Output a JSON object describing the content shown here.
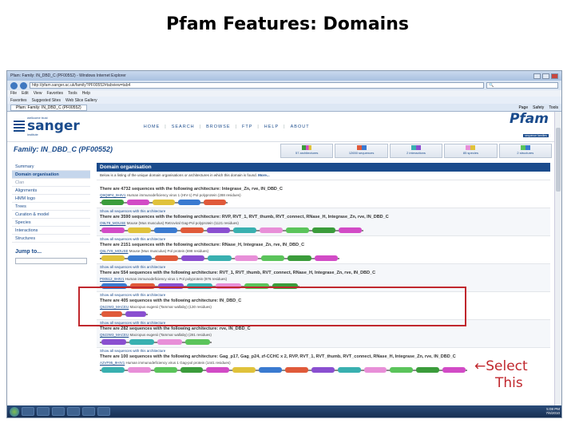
{
  "slide": {
    "title": "Pfam Features: Domains"
  },
  "browser": {
    "window_title": "Pfam: Family: IN_DBD_C (PF00552) - Windows Internet Explorer",
    "url": "http://pfam.sanger.ac.uk/family?PF00552#tabview=tab4",
    "menu": [
      "File",
      "Edit",
      "View",
      "Favorites",
      "Tools",
      "Help"
    ],
    "favorites": [
      "Favorites",
      "Suggested Sites",
      "Web Slice Gallery"
    ],
    "tab_label": "Pfam: Family: IN_DBD_C (PF00552)",
    "tools": [
      "Page",
      "Safety",
      "Tools"
    ]
  },
  "site": {
    "institute_small": "wellcome trust",
    "institute": "sanger",
    "institute_sub": "institute",
    "nav": [
      "HOME",
      "SEARCH",
      "BROWSE",
      "FTP",
      "HELP",
      "ABOUT"
    ],
    "pfam_logo": "Pfam",
    "pfam_tag": "sequence families"
  },
  "family": {
    "title": "Family: IN_DBD_C (PF00552)",
    "summary_tabs": [
      "57 architectures",
      "12650 sequences",
      "2 interactions",
      "85 species",
      "2 structures"
    ]
  },
  "sidebar": {
    "items": [
      {
        "label": "Summary",
        "state": "normal"
      },
      {
        "label": "Domain organisation",
        "state": "active"
      },
      {
        "label": "Clan",
        "state": "dim"
      },
      {
        "label": "Alignments",
        "state": "normal"
      },
      {
        "label": "HMM logo",
        "state": "normal"
      },
      {
        "label": "Trees",
        "state": "normal"
      },
      {
        "label": "Curation & model",
        "state": "normal"
      },
      {
        "label": "Species",
        "state": "normal"
      },
      {
        "label": "Interactions",
        "state": "normal"
      },
      {
        "label": "Structures",
        "state": "normal"
      }
    ],
    "jump_label": "Jump to..."
  },
  "content": {
    "panel_title": "Domain organisation",
    "intro": "Below is a listing of the unique domain organisations or architectures in which this domain is found.",
    "intro_more": "More...",
    "architectures": [
      {
        "show": "",
        "heading": "There are 4732 sequences with the following architecture: Integrase_Zn, rve, IN_DBD_C",
        "acc": "Q9Q9P4_9HIV1",
        "desc": "Human immunodeficiency virus 1 (HIV-1) Pol polyprotein (288 residues)"
      },
      {
        "show": "Show all sequences with this architecture",
        "heading": "There are 3590 sequences with the following architecture: RVP, RVT_1, RVT_thumb, RVT_connect, RNase_H, Integrase_Zn, rve, IN_DBD_C",
        "acc": "O9LT8_MOUSE",
        "desc": "Mouse (Mus musculus) Retroviral Gag-Pol polyprotein (1121 residues)"
      },
      {
        "show": "Show all sequences with this architecture",
        "heading": "There are 2151 sequences with the following architecture: RNase_H, Integrase_Zn, rve, IN_DBD_C",
        "acc": "Q6L7Y8_MOUSE",
        "desc": "Mouse (Mus musculus) Pol protein (698 residues)"
      },
      {
        "show": "Show all sequences with this architecture",
        "heading": "There are 554 sequences with the following architecture: RVT_1, RVT_thumb, RVT_connect, RNase_H, Integrase_Zn, rve, IN_DBD_C",
        "acc": "P00512_9HIV1",
        "desc": "Human immunodeficiency virus 1 Pol polyprotein (876 residues)"
      },
      {
        "show": "Show all sequences with this architecture",
        "heading": "There are 405 sequences with the following architecture: IN_DBD_C",
        "acc": "Q9J2W3_MACEU",
        "desc": "Macropus eugenii (Tammar wallaby) (130 residues)"
      },
      {
        "show": "Show all sequences with this architecture",
        "heading": "There are 282 sequences with the following architecture: rve, IN_DBD_C",
        "acc": "Q9J2W3_MACEU",
        "desc": "Macropus eugenii (Tammar wallaby) (281 residues)"
      },
      {
        "show": "Show all sequences with this architecture",
        "heading": "There are 100 sequences with the following architecture: Gag_p17, Gag_p24, zf-CCHC x 2, RVP, RVT_1, RVT_thumb, RVT_connect, RNase_H, Integrase_Zn, rve, IN_DBD_C",
        "acc": "A2VF95_9HIV1",
        "desc": "Human immunodeficiency virus 1 Gag-pol protein (1441 residues)"
      }
    ],
    "domain_colors": [
      "#3b9c3b",
      "#d24bc6",
      "#e0c23b",
      "#3a7ad0",
      "#e05a3a",
      "#8a4fd0",
      "#39b0b0",
      "#e88fd8",
      "#5bc45b"
    ]
  },
  "annotation": {
    "callout": [
      "←Select",
      "This"
    ],
    "box_color": "#c0272d"
  },
  "taskbar": {
    "time": "5:08 PM",
    "date": "7/6/2010"
  }
}
